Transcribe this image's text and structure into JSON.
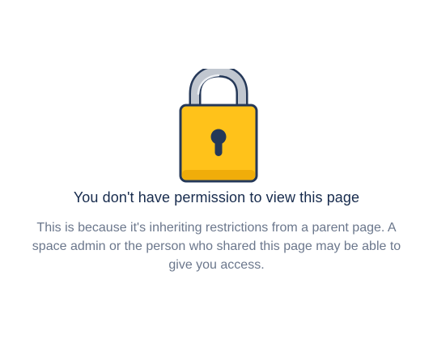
{
  "icons": {
    "lock": "lock-icon"
  },
  "colors": {
    "title": "#172b4d",
    "description": "#6b778c",
    "lock_body": "#ffc21a",
    "lock_outline": "#253858",
    "shackle": "#b3bac5"
  },
  "message": {
    "title": "You don't have permission to view this page",
    "description": "This is because it's inheriting restrictions from a parent page. A space admin or the person who shared this page may be able to give you access."
  }
}
